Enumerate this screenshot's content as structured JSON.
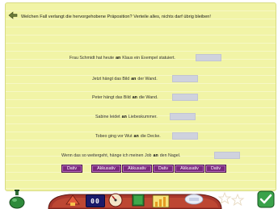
{
  "instruction": "Welchen Fall verlangt die hervorgehobene Präposition? Verteile alles, nichts darf übrig bleiben!",
  "sentences": [
    {
      "before": "Frau Schmidt hat heute",
      "prep": "an",
      "after": "Klaus ein Exempel statuiert."
    },
    {
      "before": "Jetzt hängt das Bild",
      "prep": "an",
      "after": "der Wand."
    },
    {
      "before": "Peter hängt das Bild",
      "prep": "an",
      "after": "die Wand."
    },
    {
      "before": "Sabine leidet",
      "prep": "an",
      "after": "Liebeskummer."
    },
    {
      "before": "Tobeo ging vor Wut",
      "prep": "an",
      "after": "die Decke."
    },
    {
      "before": "Wenn das so weitergeht, hänge ich meinen Job",
      "prep": "an",
      "after": "den Nagel."
    }
  ],
  "tiles": [
    "Dativ",
    "Akkusativ",
    "Akkusativ",
    "Dativ",
    "Akkusativ",
    "Dativ"
  ],
  "toolbar": {
    "counter": "00",
    "icons": [
      "potion-icon",
      "rocket-icon",
      "counter-display",
      "gauge-icon",
      "book-icon",
      "level-bars-icon",
      "speech-bubble-icon",
      "stars-icon",
      "check-icon"
    ]
  }
}
